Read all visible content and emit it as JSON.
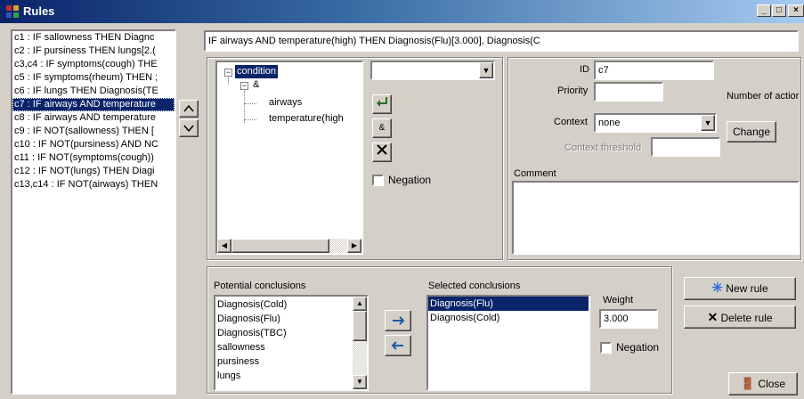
{
  "window": {
    "title": "Rules",
    "controls": [
      "_",
      "□",
      "×"
    ]
  },
  "rules": [
    {
      "text": "c1 : IF sallowness THEN Diagnc",
      "selected": false
    },
    {
      "text": "c2 : IF pursiness THEN lungs[2.(",
      "selected": false
    },
    {
      "text": "c3,c4 : IF symptoms(cough) THE",
      "selected": false
    },
    {
      "text": "c5 : IF symptoms(rheum) THEN ;",
      "selected": false
    },
    {
      "text": "c6 : IF lungs THEN Diagnosis(TE",
      "selected": false
    },
    {
      "text": "c7 : IF airways AND temperature",
      "selected": true
    },
    {
      "text": "c8 : IF airways AND temperature",
      "selected": false
    },
    {
      "text": "c9 : IF NOT(sallowness) THEN [",
      "selected": false
    },
    {
      "text": "c10 : IF NOT(pursiness) AND NC",
      "selected": false
    },
    {
      "text": "c11 : IF NOT(symptoms(cough))",
      "selected": false
    },
    {
      "text": "c12 : IF NOT(lungs) THEN Diagi",
      "selected": false
    },
    {
      "text": "c13,c14 : IF NOT(airways) THEN",
      "selected": false
    }
  ],
  "nav": {
    "up": "^",
    "down": "v"
  },
  "rule_text": "IF airways AND temperature(high) THEN Diagnosis(Flu)[3.000], Diagnosis(C",
  "tree": {
    "root": "condition",
    "and_node": "&",
    "leaves": [
      "airways",
      "temperature(high"
    ]
  },
  "condition_combo": {
    "value": ""
  },
  "tree_buttons": {
    "and": "&"
  },
  "negation_label": "Negation",
  "props": {
    "id_label": "ID",
    "id_value": "c7",
    "priority_label": "Priority",
    "priority_value": "",
    "number_of_actions_label": "Number of actior",
    "context_label": "Context",
    "context_value": "none",
    "change_button": "Change",
    "context_threshold_label": "Context threshold",
    "context_threshold_value": "",
    "comment_label": "Comment",
    "comment_value": ""
  },
  "conclusions": {
    "potential_label": "Potential conclusions",
    "potential_items": [
      "Diagnosis(Cold)",
      "Diagnosis(Flu)",
      "Diagnosis(TBC)",
      "sallowness",
      "pursiness",
      "lungs"
    ],
    "selected_label": "Selected conclusions",
    "selected_items": [
      {
        "text": "Diagnosis(Flu)",
        "selected": true
      },
      {
        "text": "Diagnosis(Cold)",
        "selected": false
      }
    ],
    "weight_label": "Weight",
    "weight_value": "3.000",
    "negation_label": "Negation"
  },
  "actions": {
    "new_rule": "New rule",
    "delete_rule": "Delete rule",
    "close": "Close"
  }
}
